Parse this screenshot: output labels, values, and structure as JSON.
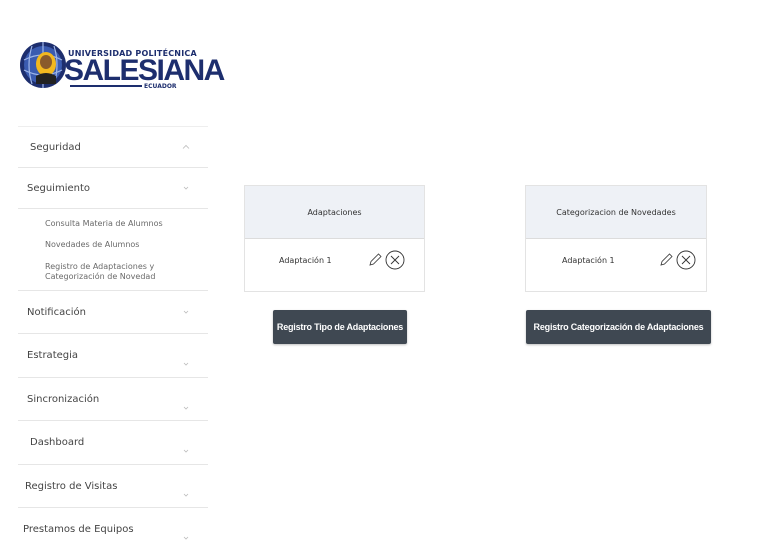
{
  "logo": {
    "university": "UNIVERSIDAD POLITÉCNICA",
    "name": "SALESIANA",
    "country": "ECUADOR",
    "colors": {
      "primary": "#1d2e6e",
      "accent": "#f2b81f"
    }
  },
  "sidebar": {
    "items": [
      {
        "label": "Seguridad",
        "chevron": "chevron-up-icon"
      },
      {
        "label": "Seguimiento",
        "chevron": "chevron-down-icon",
        "subitems": [
          "Consulta Materia de Alumnos",
          "Novedades de Alumnos",
          "Registro de Adaptaciones y Categorización de Novedad"
        ]
      },
      {
        "label": "Notificación",
        "chevron": "chevron-down-icon"
      },
      {
        "label": "Estrategia",
        "chevron": "chevron-down-icon"
      },
      {
        "label": "Sincronización",
        "chevron": "chevron-down-icon"
      },
      {
        "label": "Dashboard",
        "chevron": "chevron-down-icon"
      },
      {
        "label": "Registro de Visitas",
        "chevron": "chevron-down-icon"
      },
      {
        "label": "Prestamos de Equipos",
        "chevron": "chevron-down-icon"
      }
    ]
  },
  "cards": [
    {
      "header": "Adaptaciones",
      "row_label": "Adaptación 1",
      "button_label": "Registro Tipo de Adaptaciones"
    },
    {
      "header": "Categorizacion de Novedades",
      "row_label": "Adaptación 1",
      "button_label": "Registro Categorización de Adaptaciones"
    }
  ],
  "colors": {
    "header_bg": "#eef1f6",
    "button_bg": "#3f4852",
    "button_text": "#ffffff"
  }
}
